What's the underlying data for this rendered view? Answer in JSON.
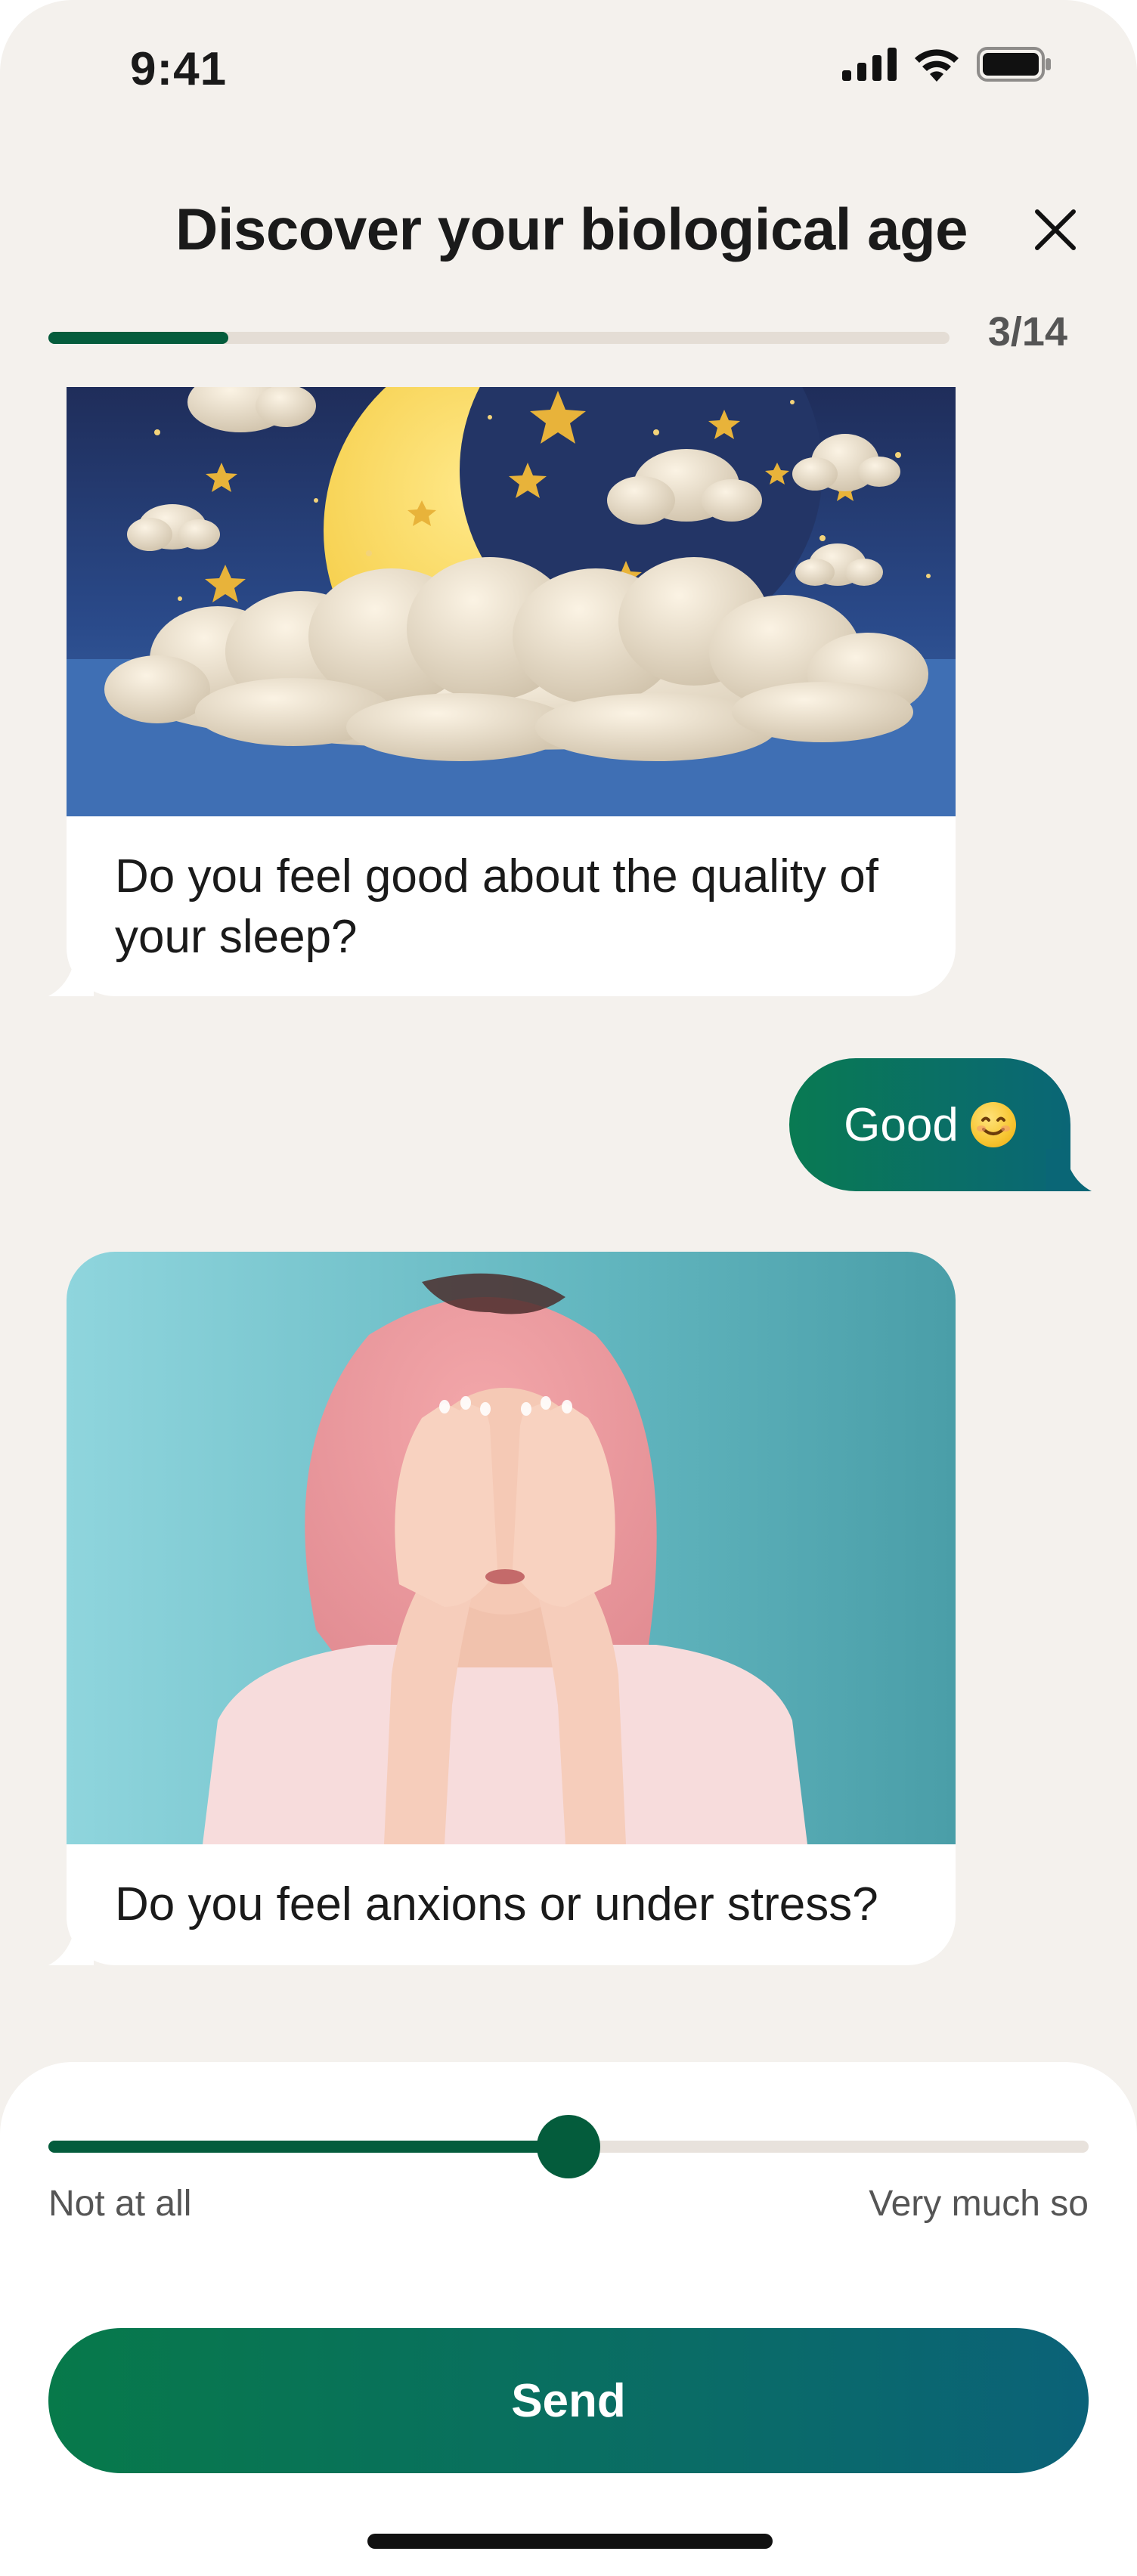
{
  "status_bar": {
    "time": "9:41",
    "icons": [
      "cellular-signal-icon",
      "wifi-icon",
      "battery-icon"
    ]
  },
  "header": {
    "title": "Discover your biological age",
    "close_icon": "close-icon"
  },
  "progress": {
    "current": 3,
    "total": 14,
    "label": "3/14",
    "fraction": 0.2
  },
  "chat": {
    "question_1": {
      "image": "night-moon-clouds-illustration",
      "text": "Do you feel good about the quality of your sleep?"
    },
    "reply_1": {
      "text": "Good",
      "emoji": "smiling-face-emoji"
    },
    "question_2": {
      "image": "woman-covering-face-photo",
      "text": "Do you feel anxions or under stress?"
    }
  },
  "answer": {
    "slider_value": 0.5,
    "min_label": "Not at all",
    "max_label": "Very much so",
    "send_label": "Send"
  },
  "colors": {
    "background": "#f4f1ed",
    "accent_dark_green": "#045c3c",
    "gradient_start": "#07794a",
    "gradient_end": "#0b6278",
    "track": "#e4ddd5"
  }
}
